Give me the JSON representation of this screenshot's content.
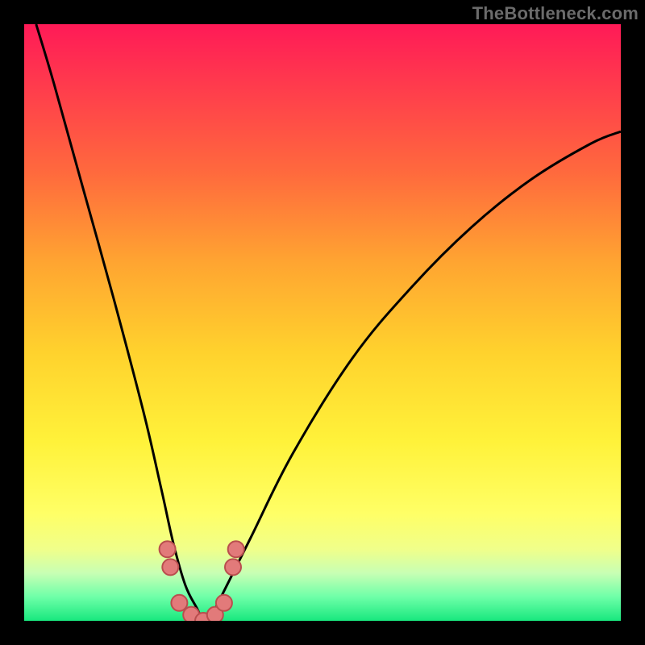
{
  "watermark": "TheBottleneck.com",
  "colors": {
    "page_bg": "#000000",
    "gradient_top": "#ff1a57",
    "gradient_mid1": "#ff6a3d",
    "gradient_mid2": "#ffd22d",
    "gradient_mid3": "#fff23a",
    "gradient_bottom": "#18e87e",
    "curve_stroke": "#000000",
    "marker_fill": "#e27a7a",
    "marker_stroke": "#b94e4e"
  },
  "chart_data": {
    "type": "line",
    "title": "",
    "xlabel": "",
    "ylabel": "",
    "xlim": [
      0,
      100
    ],
    "ylim": [
      0,
      100
    ],
    "grid": false,
    "series": [
      {
        "name": "bottleneck-curve",
        "x": [
          2,
          5,
          10,
          15,
          20,
          23,
          25,
          27,
          29,
          30,
          31,
          32,
          34,
          38,
          45,
          55,
          65,
          75,
          85,
          95,
          100
        ],
        "values": [
          100,
          90,
          72,
          54,
          35,
          22,
          13,
          6,
          2,
          0,
          0,
          2,
          6,
          14,
          28,
          44,
          56,
          66,
          74,
          80,
          82
        ]
      }
    ],
    "markers": [
      {
        "x": 24,
        "y": 12
      },
      {
        "x": 24.5,
        "y": 9
      },
      {
        "x": 26,
        "y": 3
      },
      {
        "x": 28,
        "y": 1
      },
      {
        "x": 30,
        "y": 0
      },
      {
        "x": 32,
        "y": 1
      },
      {
        "x": 33.5,
        "y": 3
      },
      {
        "x": 35,
        "y": 9
      },
      {
        "x": 35.5,
        "y": 12
      }
    ],
    "notes": "V-shaped bottleneck curve on rainbow gradient; minimum (~0%) near x≈30–31. Right branch rises with decreasing slope; left branch steeper. Salmon dotted markers cluster around the trough."
  }
}
